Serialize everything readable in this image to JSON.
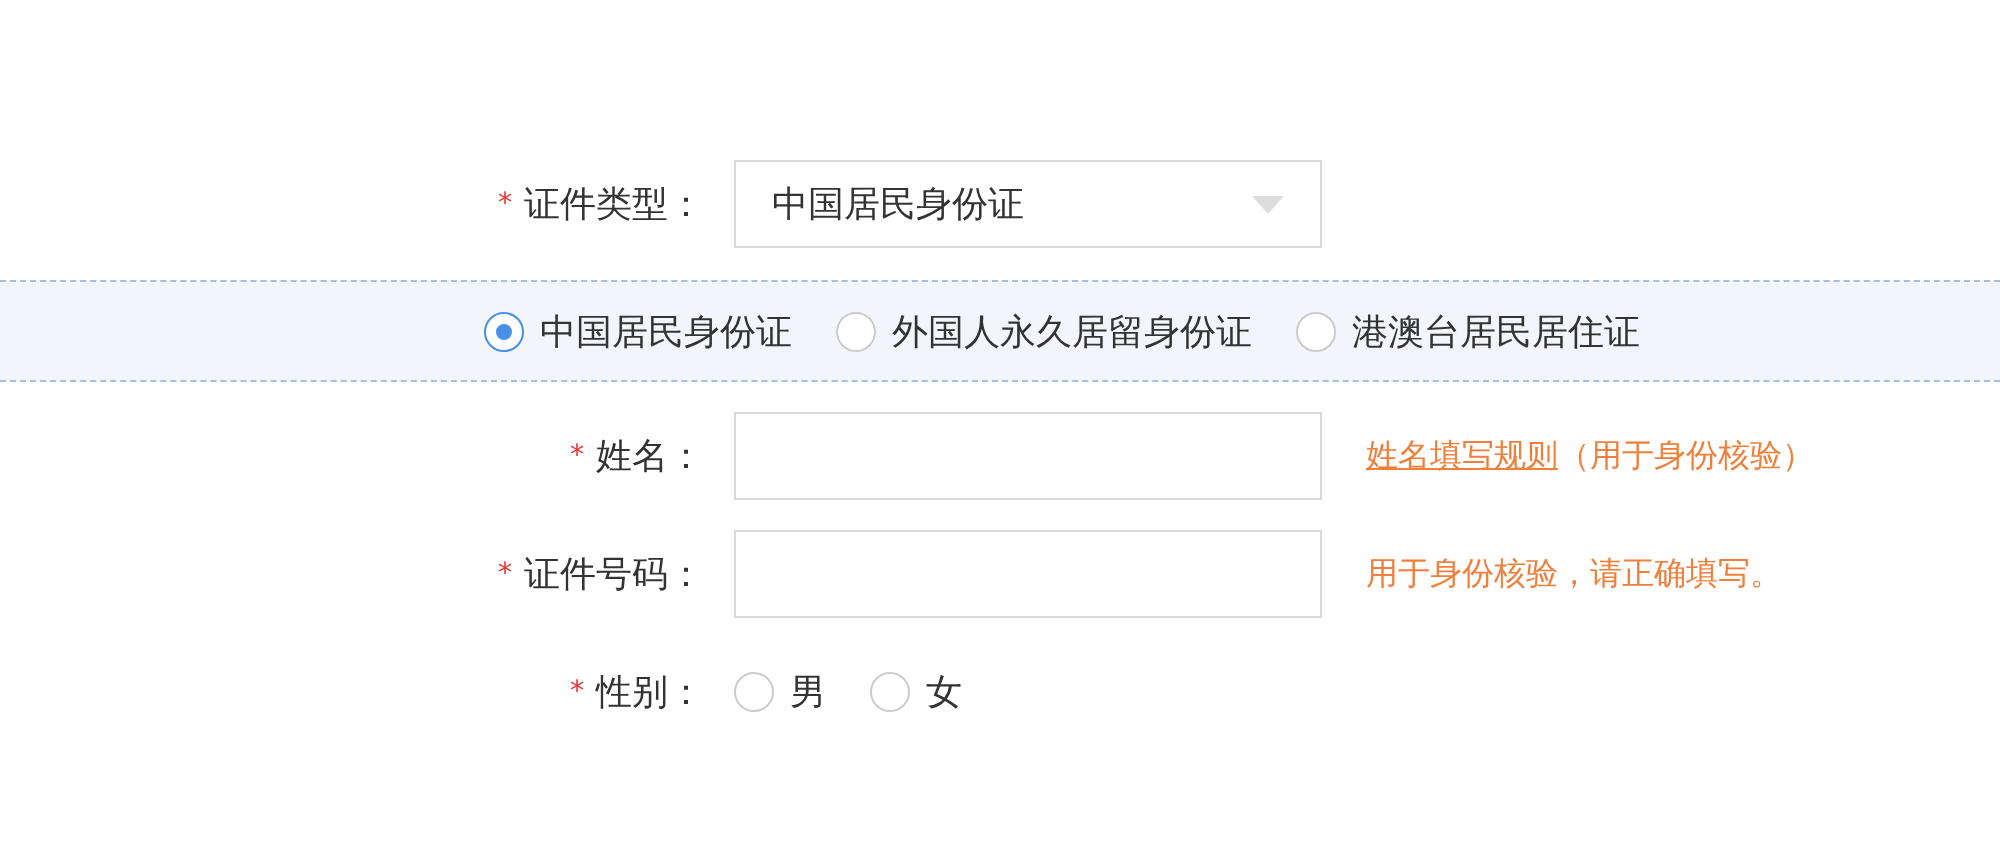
{
  "id_type": {
    "required_mark": "*",
    "label": "证件类型：",
    "value": "中国居民身份证"
  },
  "id_type_options": [
    {
      "label": "中国居民身份证",
      "selected": true
    },
    {
      "label": "外国人永久居留身份证",
      "selected": false
    },
    {
      "label": "港澳台居民居住证",
      "selected": false
    }
  ],
  "fields": [
    {
      "required_mark": "*",
      "label": "姓名：",
      "hint_link": "姓名填写规则",
      "hint": "（用于身份核验）"
    },
    {
      "required_mark": "*",
      "label": "证件号码：",
      "hint": "用于身份核验，请正确填写。"
    }
  ],
  "gender": {
    "required_mark": "*",
    "label": "性别：",
    "options": [
      {
        "label": "男",
        "selected": false
      },
      {
        "label": "女",
        "selected": false
      }
    ]
  }
}
